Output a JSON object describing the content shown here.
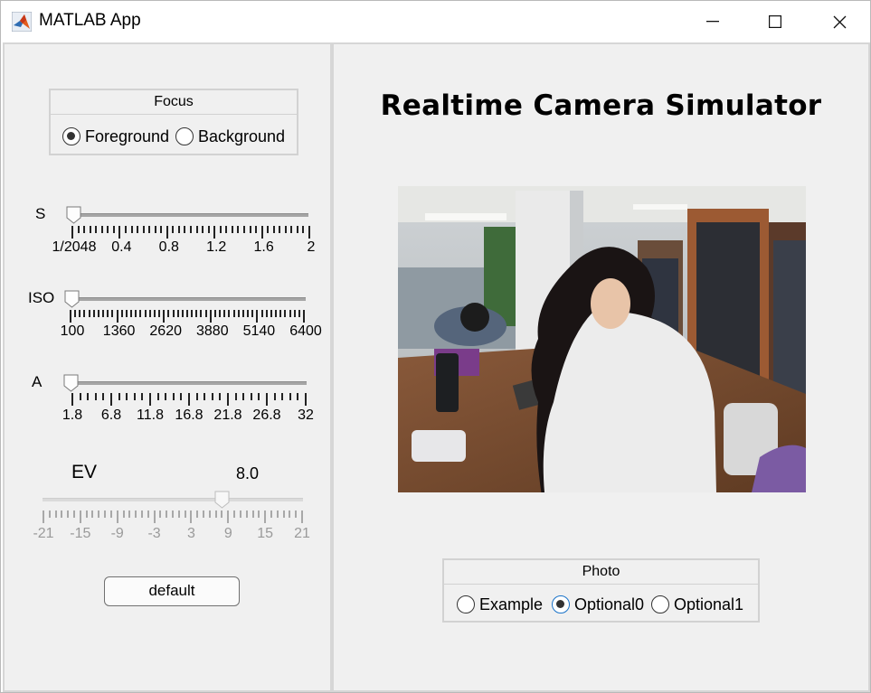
{
  "window": {
    "title": "MATLAB App"
  },
  "left": {
    "focus": {
      "title": "Focus",
      "options": [
        {
          "label": "Foreground",
          "selected": true
        },
        {
          "label": "Background",
          "selected": false
        }
      ]
    },
    "sliders": [
      {
        "label": "S",
        "value": "1/2048",
        "ticks": [
          "1/2048",
          "0.4",
          "0.8",
          "1.2",
          "1.6",
          "2"
        ]
      },
      {
        "label": "ISO",
        "value": 100,
        "ticks": [
          "100",
          "1360",
          "2620",
          "3880",
          "5140",
          "6400"
        ]
      },
      {
        "label": "A",
        "value": 1.8,
        "ticks": [
          "1.8",
          "6.8",
          "11.8",
          "16.8",
          "21.8",
          "26.8",
          "32"
        ]
      }
    ],
    "ev": {
      "label": "EV",
      "value_text": "8.0",
      "value": 8.0,
      "enabled": false,
      "ticks": [
        "-21",
        "-15",
        "-9",
        "-3",
        "3",
        "9",
        "15",
        "21"
      ]
    },
    "default_button": "default"
  },
  "right": {
    "title": "Realtime Camera Simulator",
    "photo": {
      "title": "Photo",
      "options": [
        {
          "label": "Example",
          "selected": false
        },
        {
          "label": "Optional0",
          "selected": true
        },
        {
          "label": "Optional1",
          "selected": false
        }
      ]
    }
  },
  "colors": {
    "panel_bg": "#f0f0f0",
    "radio_selected": "#1a73c9"
  }
}
